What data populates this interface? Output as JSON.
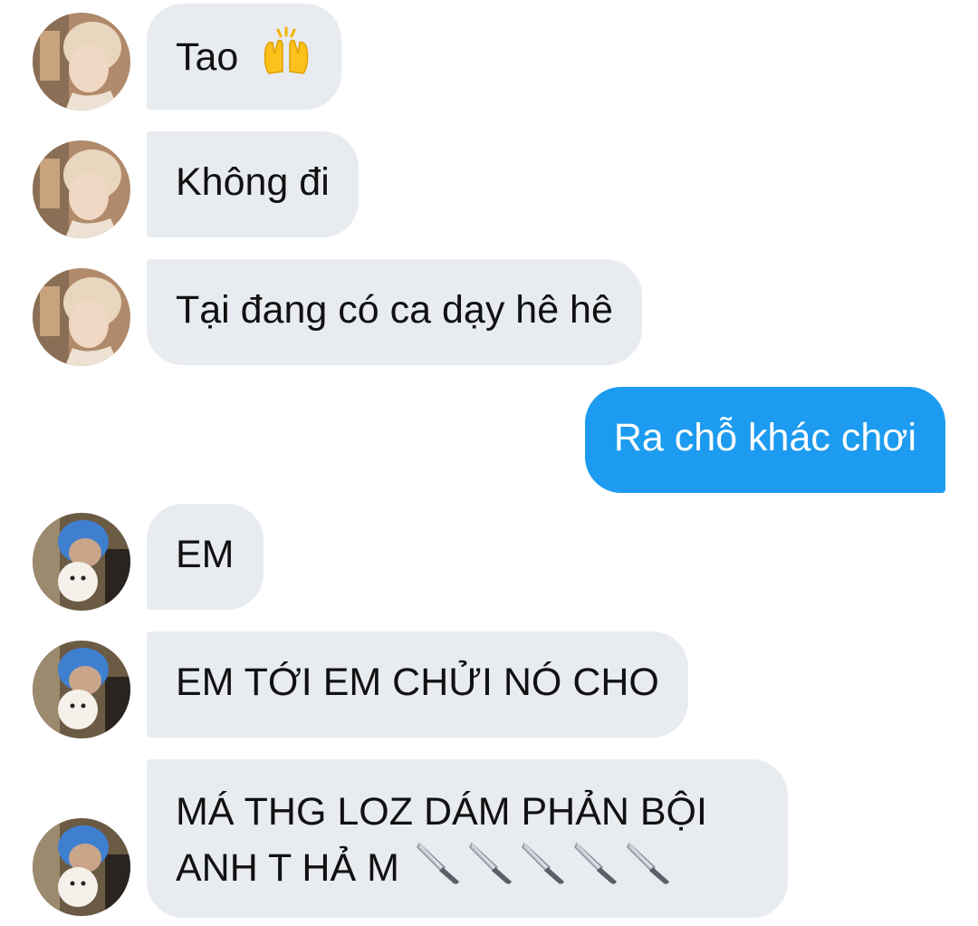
{
  "conversation": {
    "messages": [
      {
        "id": "m1",
        "sender": "contact_a",
        "text": "Tao",
        "trailing_emoji": "raising-hands-icon"
      },
      {
        "id": "m2",
        "sender": "contact_a",
        "text": "Không đi"
      },
      {
        "id": "m3",
        "sender": "contact_a",
        "text": "Tại đang có ca dạy hê hê"
      },
      {
        "id": "m4",
        "sender": "me",
        "text": "Ra chỗ khác chơi"
      },
      {
        "id": "m5",
        "sender": "contact_b",
        "text": "EM"
      },
      {
        "id": "m6",
        "sender": "contact_b",
        "text": "EM TỚI EM CHỬI NÓ CHO"
      },
      {
        "id": "m7",
        "sender": "contact_b",
        "line1": "MÁ THG LOZ DÁM PHẢN BỘI",
        "line2": "ANH T HẢ M",
        "trailing_emoji": "kitchen-knife-icon",
        "trailing_emoji_count": 5
      }
    ]
  },
  "colors": {
    "incoming_bubble": "#e8ebef",
    "outgoing_bubble": "#1d9bf0",
    "incoming_text": "#111111",
    "outgoing_text": "#ffffff"
  }
}
